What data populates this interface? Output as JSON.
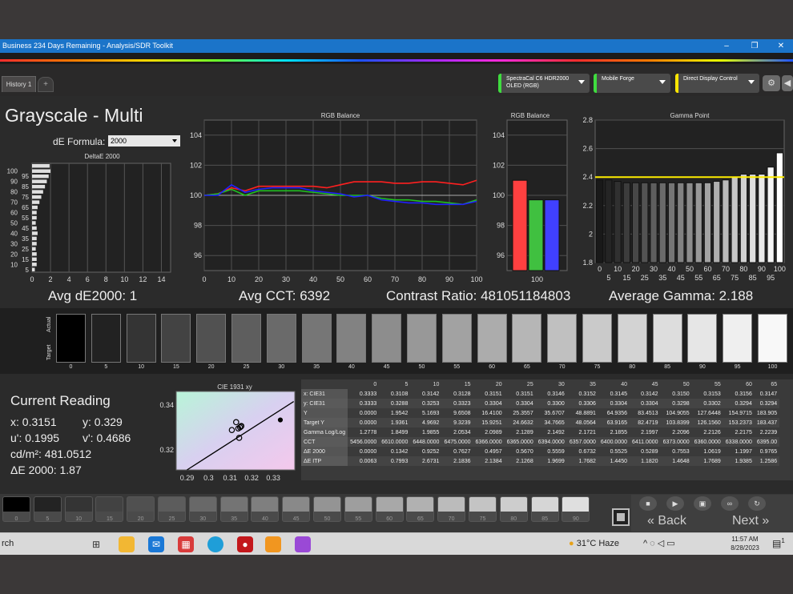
{
  "window": {
    "title": "Business 234 Days Remaining  - Analysis/SDR Toolkit",
    "minimize": "–",
    "maximize": "❐",
    "close": "✕"
  },
  "toolbar": {
    "history_tab": "History 1",
    "add_tab": "+",
    "meter_select": {
      "line1": "SpectraCal C6 HDR2000",
      "line2": "OLED (RGB)"
    },
    "pattern_select": {
      "line1": "Mobile Forge"
    },
    "display_select": {
      "line1": "Direct Display Control"
    },
    "settings_icon": "⚙",
    "back_icon": "◀"
  },
  "page": {
    "title": "Grayscale - Multi",
    "de_formula_label": "dE Formula:",
    "de_formula_value": "2000"
  },
  "stats": {
    "avg_de": "Avg dE2000: 1",
    "avg_cct": "Avg CCT: 6392",
    "contrast": "Contrast Ratio: 481051184803",
    "avg_gamma": "Average Gamma: 2.188"
  },
  "charts": {
    "deltae": {
      "title": "DeltaE 2000"
    },
    "rgb_balance": {
      "title": "RGB Balance"
    },
    "rgb_bar": {
      "title": "RGB Balance"
    },
    "gamma": {
      "title": "Gamma Point"
    },
    "cie": {
      "title": "CIE 1931 xy"
    }
  },
  "chart_data": [
    {
      "type": "bar",
      "title": "DeltaE 2000",
      "orientation": "horizontal",
      "categories": [
        "0",
        "5",
        "10",
        "15",
        "20",
        "25",
        "30",
        "35",
        "40",
        "45",
        "50",
        "55",
        "60",
        "65",
        "70",
        "75",
        "80",
        "85",
        "90",
        "95",
        "100"
      ],
      "values": [
        0.3,
        0.5,
        0.5,
        0.5,
        0.4,
        0.5,
        0.5,
        0.6,
        0.5,
        0.4,
        0.5,
        0.5,
        0.6,
        0.8,
        1.0,
        1.2,
        1.4,
        1.6,
        1.8,
        2.0,
        1.9
      ],
      "xlim": [
        0,
        15
      ],
      "x_ticks": [
        "0",
        "2",
        "4",
        "6",
        "8",
        "10",
        "12",
        "14"
      ],
      "y_ticks": [
        "5",
        "10",
        "15",
        "20",
        "25",
        "30",
        "35",
        "40",
        "45",
        "50",
        "55",
        "60",
        "65",
        "70",
        "75",
        "80",
        "85",
        "90",
        "95",
        "100"
      ]
    },
    {
      "type": "line",
      "title": "RGB Balance",
      "x": [
        0,
        5,
        10,
        15,
        20,
        25,
        30,
        35,
        40,
        45,
        50,
        55,
        60,
        65,
        70,
        75,
        80,
        85,
        90,
        95,
        100
      ],
      "series": [
        {
          "color": "#ff2020",
          "values": [
            100.0,
            100.1,
            100.5,
            100.3,
            100.6,
            100.6,
            100.6,
            100.6,
            100.6,
            100.5,
            100.7,
            100.9,
            100.9,
            100.9,
            100.8,
            100.8,
            100.9,
            100.9,
            100.8,
            100.7,
            101.0
          ]
        },
        {
          "color": "#20c020",
          "values": [
            100.0,
            100.1,
            100.4,
            100.0,
            100.3,
            100.3,
            100.3,
            100.3,
            100.2,
            100.1,
            100.0,
            100.0,
            100.0,
            99.8,
            99.7,
            99.7,
            99.6,
            99.6,
            99.5,
            99.4,
            99.7
          ]
        },
        {
          "color": "#2020ff",
          "values": [
            100.0,
            100.0,
            100.7,
            100.2,
            100.4,
            100.5,
            100.5,
            100.5,
            100.3,
            100.2,
            100.1,
            99.9,
            100.0,
            99.7,
            99.6,
            99.5,
            99.5,
            99.4,
            99.4,
            99.4,
            99.6
          ]
        }
      ],
      "xlim": [
        0,
        100
      ],
      "ylim": [
        95,
        105
      ],
      "x_ticks": [
        "0",
        "10",
        "20",
        "30",
        "40",
        "50",
        "60",
        "70",
        "80",
        "90",
        "100"
      ],
      "y_ticks": [
        "96",
        "98",
        "100",
        "102",
        "104"
      ]
    },
    {
      "type": "bar",
      "title": "RGB Balance",
      "categories": [
        "100"
      ],
      "series": [
        {
          "color": "#ff4040",
          "values": [
            101.0
          ]
        },
        {
          "color": "#40c040",
          "values": [
            99.7
          ]
        },
        {
          "color": "#4040ff",
          "values": [
            99.7
          ]
        }
      ],
      "ylim": [
        95,
        105
      ],
      "y_ticks": [
        "96",
        "98",
        "100",
        "102",
        "104"
      ]
    },
    {
      "type": "bar",
      "title": "Gamma Point",
      "categories": [
        "0",
        "5",
        "10",
        "15",
        "20",
        "25",
        "30",
        "35",
        "40",
        "45",
        "50",
        "55",
        "60",
        "65",
        "70",
        "75",
        "80",
        "85",
        "90",
        "95",
        "100"
      ],
      "values": [
        2.38,
        2.38,
        2.37,
        2.36,
        2.36,
        2.36,
        2.36,
        2.36,
        2.36,
        2.36,
        2.36,
        2.36,
        2.36,
        2.37,
        2.38,
        2.4,
        2.42,
        2.42,
        2.42,
        2.47,
        2.57
      ],
      "target": 2.4,
      "ylim": [
        1.8,
        2.8
      ],
      "y_ticks": [
        "1.8",
        "2",
        "2.2",
        "2.4",
        "2.6",
        "2.8"
      ],
      "x_ticks_top": [
        "0",
        "10",
        "20",
        "30",
        "40",
        "50",
        "60",
        "70",
        "80",
        "90",
        "100"
      ],
      "x_ticks_bottom": [
        "5",
        "15",
        "25",
        "35",
        "45",
        "55",
        "65",
        "75",
        "85",
        "95"
      ]
    },
    {
      "type": "scatter",
      "title": "CIE 1931 xy",
      "points": [
        {
          "x": 0.3108,
          "y": 0.3288
        },
        {
          "x": 0.3142,
          "y": 0.3253
        },
        {
          "x": 0.3128,
          "y": 0.3323
        },
        {
          "x": 0.3151,
          "y": 0.3304
        },
        {
          "x": 0.3146,
          "y": 0.33
        },
        {
          "x": 0.3152,
          "y": 0.3306
        },
        {
          "x": 0.3138,
          "y": 0.3295
        },
        {
          "x": 0.3333,
          "y": 0.3333
        }
      ],
      "xlim": [
        0.285,
        0.34
      ],
      "ylim": [
        0.311,
        0.346
      ],
      "x_ticks": [
        "0.29",
        "0.3",
        "0.31",
        "0.32",
        "0.33"
      ],
      "y_ticks": [
        "0.32",
        "0.34"
      ]
    }
  ],
  "swatch_labels": {
    "actual": "Actual",
    "target": "Target",
    "steps": [
      "0",
      "5",
      "10",
      "15",
      "20",
      "25",
      "30",
      "35",
      "40",
      "45",
      "50",
      "55",
      "60",
      "65",
      "70",
      "75",
      "80",
      "85",
      "90",
      "95",
      "100"
    ]
  },
  "current_reading": {
    "title": "Current Reading",
    "x": "x: 0.3151",
    "y": "y: 0.329",
    "u": "u': 0.1995",
    "v": "v': 0.4686",
    "cd": "cd/m²: 481.0512",
    "de": "ΔE 2000: 1.87"
  },
  "table": {
    "columns": [
      "0",
      "5",
      "10",
      "15",
      "20",
      "25",
      "30",
      "35",
      "40",
      "45",
      "50",
      "55",
      "60",
      "65"
    ],
    "rows": [
      {
        "label": "x: CIE31",
        "cells": [
          "0.3333",
          "0.3108",
          "0.3142",
          "0.3128",
          "0.3151",
          "0.3151",
          "0.3146",
          "0.3152",
          "0.3145",
          "0.3142",
          "0.3150",
          "0.3153",
          "0.3156",
          "0.3147"
        ]
      },
      {
        "label": "y: CIE31",
        "cells": [
          "0.3333",
          "0.3288",
          "0.3253",
          "0.3323",
          "0.3304",
          "0.3304",
          "0.3300",
          "0.3306",
          "0.3304",
          "0.3304",
          "0.3298",
          "0.3302",
          "0.3294",
          "0.3294"
        ]
      },
      {
        "label": "Y",
        "cells": [
          "0.0000",
          "1.9542",
          "5.1693",
          "9.6508",
          "16.4100",
          "25.3557",
          "35.6707",
          "48.8891",
          "64.9356",
          "83.4513",
          "104.9055",
          "127.6448",
          "154.9715",
          "183.905"
        ]
      },
      {
        "label": "Target Y",
        "cells": [
          "0.0000",
          "1.9361",
          "4.9692",
          "9.3239",
          "15.9251",
          "24.6632",
          "34.7665",
          "48.0564",
          "63.9165",
          "82.4719",
          "103.8399",
          "126.1560",
          "153.2373",
          "183.437"
        ]
      },
      {
        "label": "Gamma Log/Log",
        "cells": [
          "1.2778",
          "1.8499",
          "1.9855",
          "2.0534",
          "2.0989",
          "2.1289",
          "2.1492",
          "2.1721",
          "2.1855",
          "2.1997",
          "2.2096",
          "2.2126",
          "2.2175",
          "2.2239"
        ]
      },
      {
        "label": "CCT",
        "cells": [
          "5456.0000",
          "6610.0000",
          "6448.0000",
          "6475.0000",
          "6366.0000",
          "6365.0000",
          "6394.0000",
          "6357.0000",
          "6400.0000",
          "6411.0000",
          "6373.0000",
          "6360.0000",
          "6338.0000",
          "6395.00"
        ]
      },
      {
        "label": "ΔE 2000",
        "cells": [
          "0.0000",
          "0.1342",
          "0.9252",
          "0.7627",
          "0.4957",
          "0.5670",
          "0.5559",
          "0.6732",
          "0.5525",
          "0.5289",
          "0.7553",
          "1.0619",
          "1.1997",
          "0.9765"
        ]
      },
      {
        "label": "ΔE ITP",
        "cells": [
          "0.0063",
          "0.7993",
          "2.6731",
          "2.1836",
          "2.1384",
          "2.1268",
          "1.9699",
          "1.7682",
          "1.4450",
          "1.1820",
          "1.4648",
          "1.7689",
          "1.9385",
          "1.2586"
        ]
      }
    ]
  },
  "thumbs": {
    "steps": [
      "0",
      "5",
      "10",
      "15",
      "20",
      "25",
      "30",
      "35",
      "40",
      "45",
      "50",
      "55",
      "60",
      "65",
      "70",
      "75",
      "80",
      "85",
      "90"
    ]
  },
  "nav": {
    "back": "Back",
    "next": "Next",
    "back_icon": "«",
    "next_icon": "»"
  },
  "taskbar": {
    "search": "rch",
    "weather": "31°C  Haze",
    "time": "11:57 AM",
    "date": "8/28/2023",
    "notif_count": "1"
  }
}
